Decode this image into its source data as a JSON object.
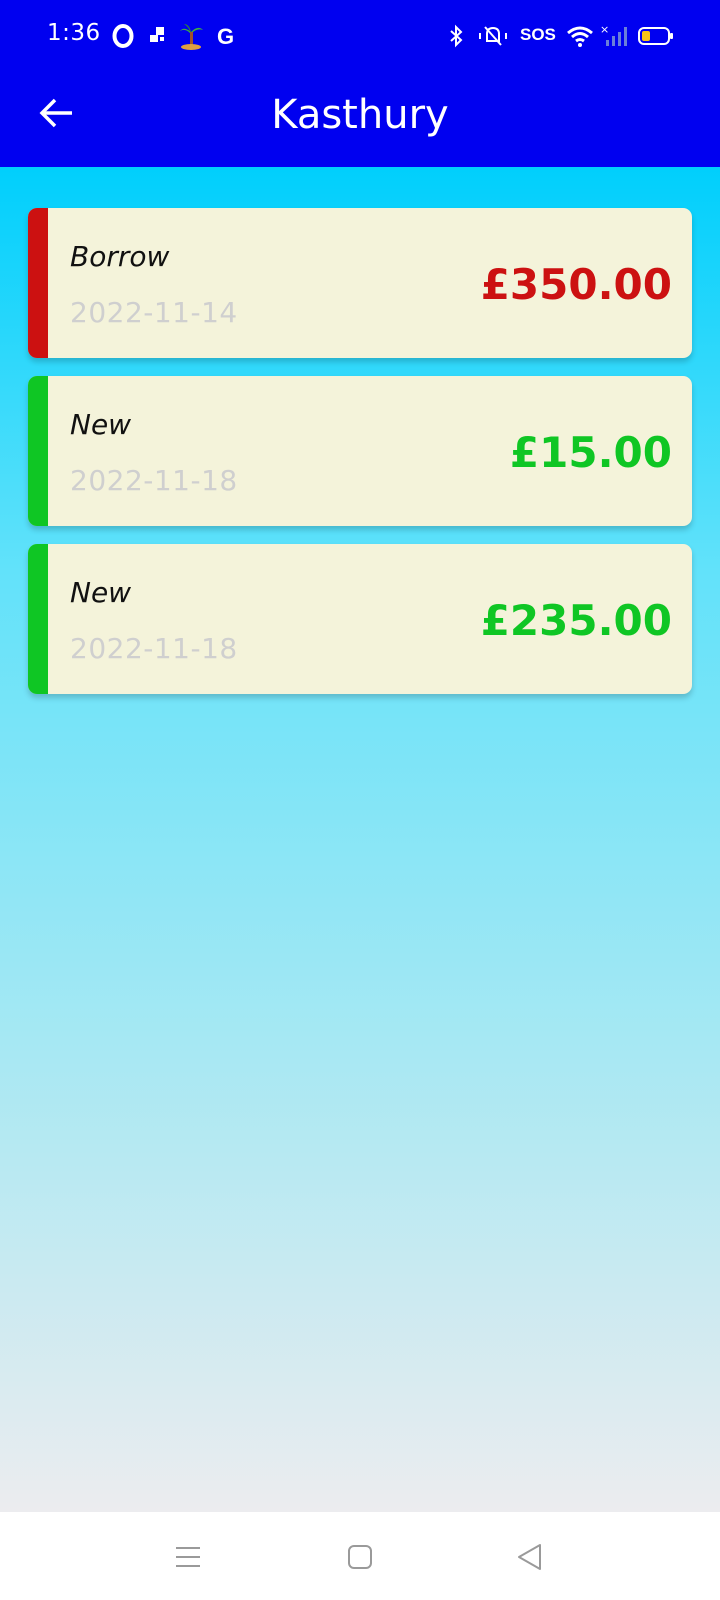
{
  "status_bar": {
    "time": "1:36",
    "sos": "SOS",
    "icons": [
      "opera-icon",
      "app-icon",
      "palm-tree-icon",
      "google-icon",
      "bluetooth-icon",
      "mute-icon",
      "wifi-icon",
      "signal-icon",
      "battery-icon"
    ]
  },
  "header": {
    "title": "Kasthury",
    "back_icon": "arrow-left-icon"
  },
  "transactions": [
    {
      "type": "Borrow",
      "date": "2022-11-14",
      "amount": "£350.00",
      "color": "#cc1111"
    },
    {
      "type": "New",
      "date": "2022-11-18",
      "amount": "£15.00",
      "color": "#0fc624"
    },
    {
      "type": "New",
      "date": "2022-11-18",
      "amount": "£235.00",
      "color": "#0fc624"
    }
  ],
  "colors": {
    "appbar": "#0000f0",
    "card_bg": "#f4f3da",
    "borrow": "#cc1111",
    "new": "#0fc624"
  },
  "nav": {
    "icons": [
      "menu-icon",
      "home-square-icon",
      "back-triangle-icon"
    ]
  }
}
